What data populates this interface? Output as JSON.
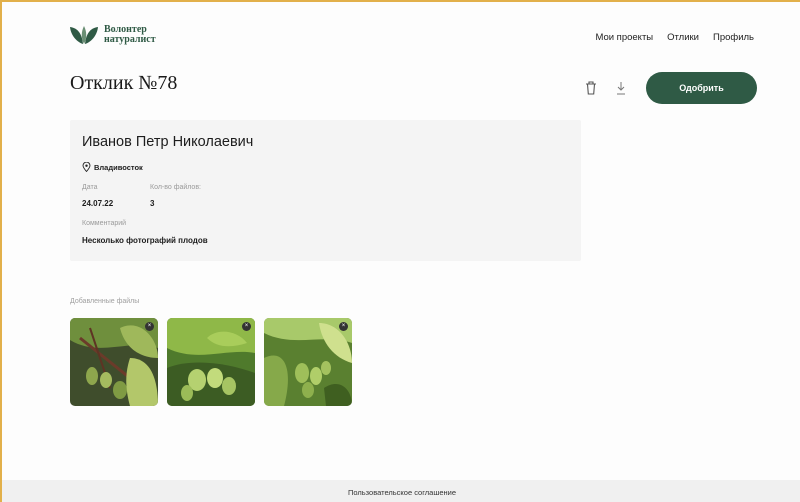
{
  "brand": {
    "line1": "Волонтер",
    "line2": "натуралист",
    "logo_icon": "leaves-icon",
    "color": "#2f5a45"
  },
  "nav": {
    "items": [
      "Мои проекты",
      "Отлики",
      "Профиль"
    ]
  },
  "page": {
    "title": "Отклик №78"
  },
  "actions": {
    "approve_label": "Одобрить",
    "delete_icon": "trash-icon",
    "download_icon": "download-icon"
  },
  "response": {
    "name": "Иванов Петр Николаевич",
    "location": "Владивосток",
    "date_label": "Дата",
    "date": "24.07.22",
    "files_count_label": "Кол-во файлов:",
    "files_count": "3",
    "comment_label": "Комментарий",
    "comment": "Несколько фотографий плодов"
  },
  "files": {
    "label": "Добавленные файлы",
    "count": 3
  },
  "footer": {
    "agreement": "Пользовательское соглашение"
  }
}
